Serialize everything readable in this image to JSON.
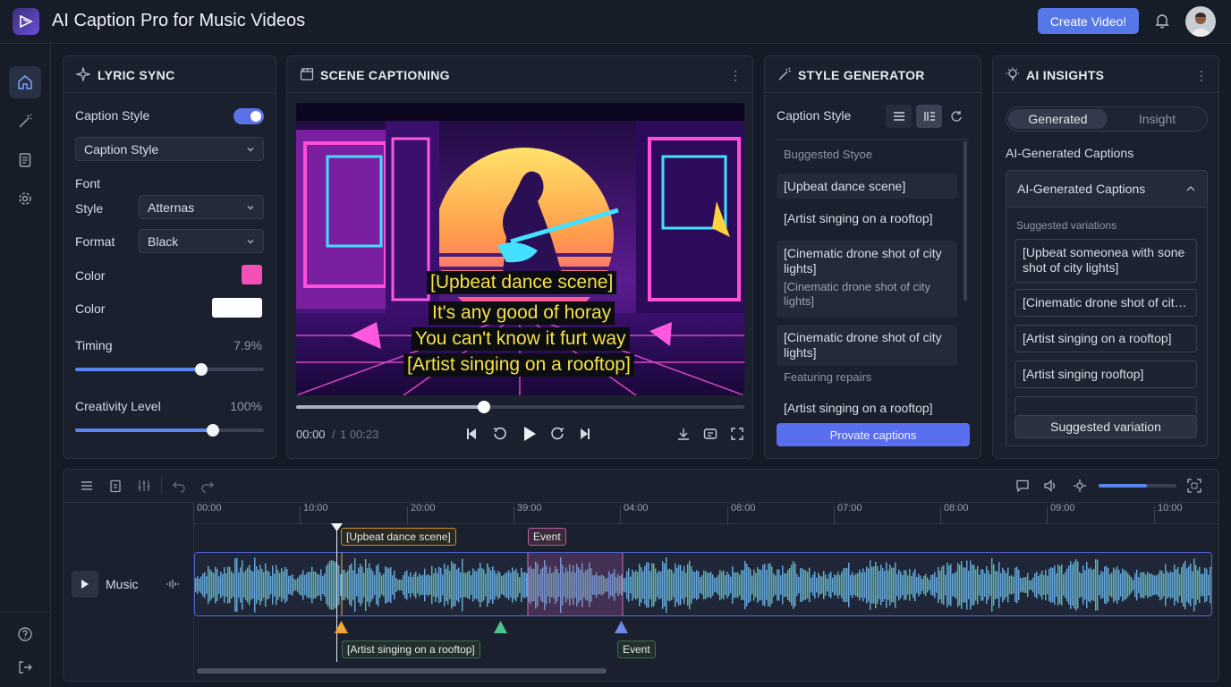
{
  "app": {
    "title": "AI Caption Pro for Music Videos",
    "create_button": "Create Video!"
  },
  "lyric_sync": {
    "title": "LYRIC SYNC",
    "caption_style_label": "Caption Style",
    "caption_style_toggle_on": true,
    "caption_style_select": "Caption Style",
    "font_label": "Font",
    "style_label": "Style",
    "style_value": "Atternas",
    "format_label": "Format",
    "format_value": "Black",
    "color1_label": "Color",
    "color1_value": "#f24fb7",
    "color2_label": "Color",
    "color2_value": "#ffffff",
    "timing_label": "Timing",
    "timing_value": "7.9%",
    "timing_level": 0.67,
    "creativity_label": "Creativity Level",
    "creativity_value": "100%",
    "creativity_level": 0.73
  },
  "scene_captioning": {
    "title": "SCENE CAPTIONING",
    "captions": [
      "[Upbeat dance scene]",
      "It's any good of horay",
      "You can't know it furt way",
      "[Artist singing on a rooftop]"
    ],
    "current_time": "00:00",
    "separator": "/",
    "total_time": "1 00:23",
    "progress": 0.42
  },
  "style_generator": {
    "title": "STYLE GENERATOR",
    "caption_style_label": "Caption Style",
    "suggested_header": "Buggested Styoe",
    "items": [
      {
        "text": "[Upbeat dance scene]",
        "sub": ""
      },
      {
        "text": "[Artist singing on a rooftop]",
        "sub": ""
      },
      {
        "text": "[Cinematic drone shot of city lights]",
        "sub": "[Cinematic drone shot of city lights]"
      },
      {
        "text": "[Cinematic drone shot of city lights]",
        "sub": ""
      }
    ],
    "featuring_label": "Featuring repairs",
    "last_item": "[Artist singing on a rooftop]",
    "generate_button": "Provate captions"
  },
  "ai_insights": {
    "title": "AI INSIGHTS",
    "tabs": [
      "Generated",
      "Insight"
    ],
    "section_title": "AI-Generated Captions",
    "accordion_title": "AI-Generated Captions",
    "suggested_label": "Suggested variations",
    "variations": [
      "[Upbeat someonea with sone shot of city lights]",
      "[Cinematic drone shot of city...",
      "[Artist singing on a rooftop]",
      "[Artist singing rooftop]"
    ],
    "suggested_button": "Suggested variation"
  },
  "timeline": {
    "ticks": [
      "00:00",
      "10:00",
      "20:00",
      "39:00",
      "04:00",
      "08:00",
      "07:00",
      "08:00",
      "09:00",
      "10:00"
    ],
    "track_label": "Music",
    "volume_level": 0.62,
    "tags_top": [
      "[Upbeat dance scene]",
      "Event"
    ],
    "tags_bottom": [
      "[Artist singing on a rooftop]",
      "Event"
    ]
  }
}
